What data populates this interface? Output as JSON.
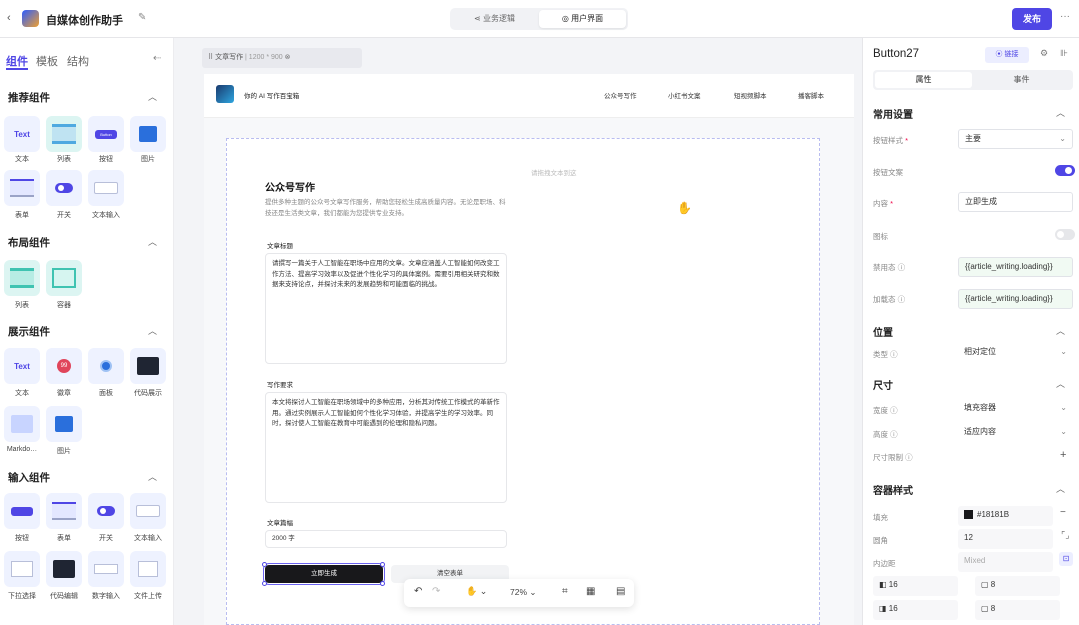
{
  "app": {
    "title": "自媒体创作助手"
  },
  "header": {
    "tabs": [
      {
        "label": "业务逻辑"
      },
      {
        "label": "用户界面"
      }
    ],
    "publish": "发布",
    "more": "···"
  },
  "left": {
    "tabs": [
      "组件",
      "模板",
      "结构"
    ],
    "sections": [
      {
        "title": "推荐组件",
        "items": [
          "文本",
          "列表",
          "按钮",
          "图片",
          "表单",
          "开关",
          "文本输入"
        ]
      },
      {
        "title": "布局组件",
        "items": [
          "列表",
          "容器"
        ]
      },
      {
        "title": "展示组件",
        "items": [
          "文本",
          "徽章",
          "面板",
          "代码展示",
          "Markdo…",
          "图片"
        ]
      },
      {
        "title": "输入组件",
        "items": [
          "按钮",
          "表单",
          "开关",
          "文本输入",
          "下拉选择",
          "代码编辑",
          "数字输入",
          "文件上传"
        ]
      }
    ],
    "tile_text": {
      "text": "Text",
      "badge": "99",
      "button": "Button"
    }
  },
  "canvas": {
    "page_tab": "文章写作",
    "page_size": "1200 * 900",
    "page_nav": {
      "brand": "你的 AI 写作百宝箱",
      "links": [
        "公众号写作",
        "小红书文案",
        "短视频脚本",
        "播客脚本"
      ]
    },
    "hint": "请拖拽文本到这",
    "heading": "公众号写作",
    "intro": "提供多种主题的公众号文章写作服务，帮助您轻松生成高质量内容。无论是职场、科技还是生活类文章，我们都能为您提供专业支持。",
    "f1_label": "文章标题",
    "f1_value": "请撰写一篇关于人工智能在职场中应用的文章。文章应涵盖人工智能如何改变工作方法、提高学习效率以及促进个性化学习的具体案例。需要引用相关研究和数据来支持论点，并探讨未来的发展趋势和可能面临的挑战。",
    "f2_label": "写作要求",
    "f2_value": "本文将探讨人工智能在职场领域中的多种应用，分析其对传统工作模式的革新作用。通过实例展示人工智能如何个性化学习体验，并提高学生的学习效率。同时，探讨使人工智能在教育中可能遇到的伦理和隐私问题。",
    "f3_label": "文章篇幅",
    "f3_value": "2000 字",
    "btn_generate": "立即生成",
    "btn_clear": "清空表单",
    "zoom": "72%"
  },
  "right": {
    "component": "Button27",
    "locate": "⦿ 链接",
    "tabs": [
      "属性",
      "事件"
    ],
    "sections": {
      "common": "常用设置",
      "position": "位置",
      "size": "尺寸",
      "container": "容器样式"
    },
    "fields": {
      "style_label": "按钮样式",
      "style_value": "主要",
      "text_label": "按钮文案",
      "content_label": "内容",
      "content_value": "立即生成",
      "icon_label": "图标",
      "disabled_label": "禁用态",
      "disabled_value": "{{article_writing.loading}}",
      "loading_label": "加载态",
      "loading_value": "{{article_writing.loading}}",
      "type_label": "类型",
      "type_value": "相对定位",
      "width_label": "宽度",
      "width_value": "填充容器",
      "height_label": "高度",
      "height_value": "适应内容",
      "sizectl_label": "尺寸限制",
      "fill_label": "填充",
      "fill_value": "#18181B",
      "radius_label": "圆角",
      "radius_value": "12",
      "padding_label": "内边距",
      "padding_value": "Mixed",
      "pad_a": "16",
      "pad_b": "8",
      "pad_c": "16",
      "pad_d": "8"
    },
    "colors": {
      "accent": "#4f46e5",
      "fill": "#18181B"
    }
  }
}
